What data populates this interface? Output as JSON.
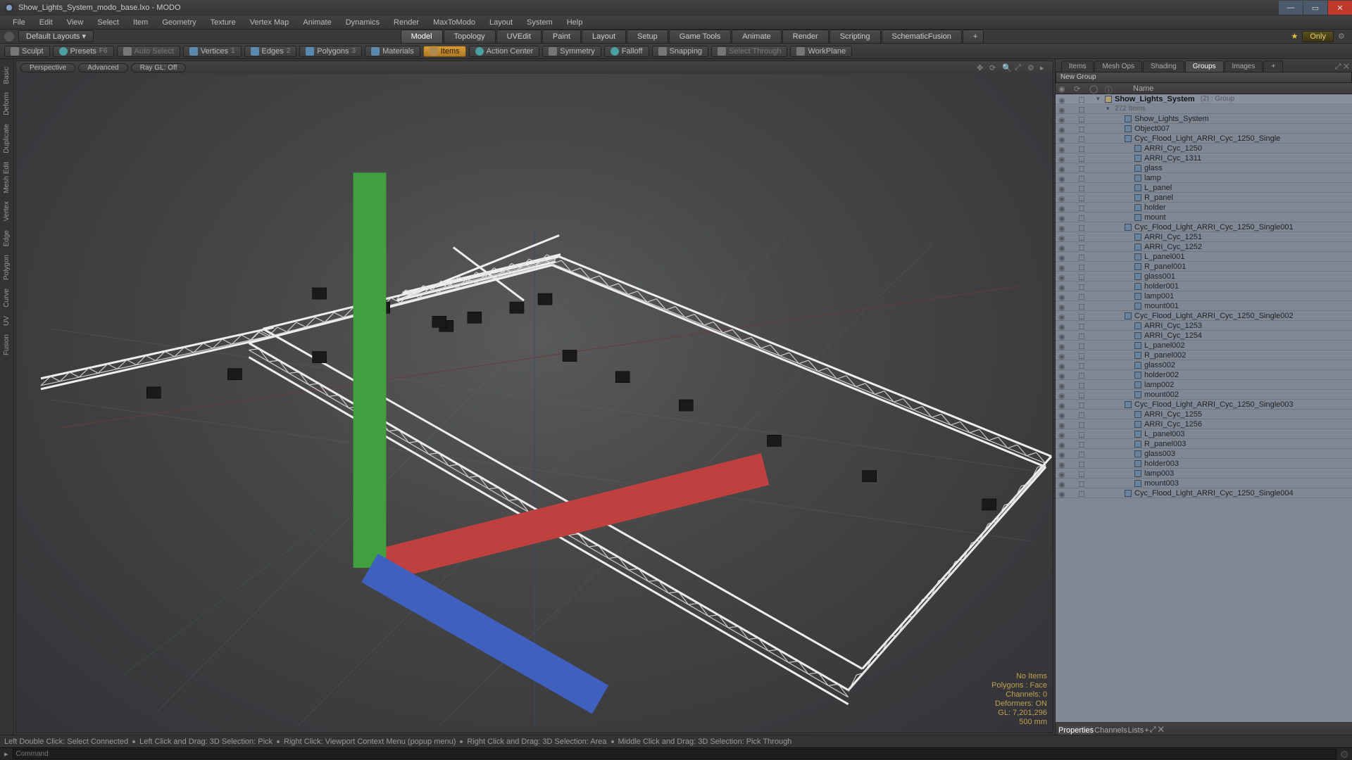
{
  "window": {
    "title": "Show_Lights_System_modo_base.lxo - MODO"
  },
  "menu": [
    "File",
    "Edit",
    "View",
    "Select",
    "Item",
    "Geometry",
    "Texture",
    "Vertex Map",
    "Animate",
    "Dynamics",
    "Render",
    "MaxToModo",
    "Layout",
    "System",
    "Help"
  ],
  "layoutbar": {
    "dropdown": "Default Layouts",
    "tabs": [
      "Model",
      "Topology",
      "UVEdit",
      "Paint",
      "Layout",
      "Setup",
      "Game Tools",
      "Animate",
      "Render",
      "Scripting",
      "SchematicFusion"
    ],
    "active_tab": "Model",
    "only": "Only"
  },
  "toolbar": [
    {
      "label": "Sculpt",
      "icon": "grey"
    },
    {
      "label": "Presets",
      "icon": "cyan",
      "kbd": "F6"
    },
    {
      "label": "Auto Select",
      "icon": "grey",
      "muted": true
    },
    {
      "label": "Vertices",
      "icon": "blue",
      "kbd": "1"
    },
    {
      "label": "Edges",
      "icon": "blue",
      "kbd": "2"
    },
    {
      "label": "Polygons",
      "icon": "blue",
      "kbd": "3"
    },
    {
      "label": "Materials",
      "icon": "blue"
    },
    {
      "label": "Items",
      "icon": "gold",
      "active": true
    },
    {
      "label": "Action Center",
      "icon": "cyan"
    },
    {
      "label": "Symmetry",
      "icon": "grey"
    },
    {
      "label": "Falloff",
      "icon": "cyan"
    },
    {
      "label": "Snapping",
      "icon": "grey"
    },
    {
      "label": "Select Through",
      "icon": "grey",
      "muted": true
    },
    {
      "label": "WorkPlane",
      "icon": "grey"
    }
  ],
  "vtoolbar": [
    "Basic",
    "Deform",
    "Duplicate",
    "Mesh Edit",
    "Vertex",
    "Edge",
    "Polygon",
    "Curve",
    "UV",
    "Fusion"
  ],
  "viewport": {
    "pills": [
      "Perspective",
      "Advanced",
      "Ray GL: Off"
    ],
    "stats": {
      "line1": "No Items",
      "line2": "Polygons : Face",
      "line3": "Channels: 0",
      "line4": "Deformers: ON",
      "line5": "GL: 7,201,296",
      "line6": "500 mm"
    }
  },
  "statusbar": {
    "s1": "Left Double Click: Select Connected",
    "s2": "Left Click and Drag: 3D Selection: Pick",
    "s3": "Right Click: Viewport Context Menu (popup menu)",
    "s4": "Right Click and Drag: 3D Selection: Area",
    "s5": "Middle Click and Drag: 3D Selection: Pick Through"
  },
  "command": {
    "placeholder": "Command"
  },
  "rpanel": {
    "tabs": [
      "Items",
      "Mesh Ops",
      "Shading",
      "Groups",
      "Images"
    ],
    "active_tab": "Groups",
    "new_group": "New Group",
    "header_name": "Name",
    "group_name": "Show_Lights_System",
    "group_count": "(2)",
    "group_suffix": ": Group",
    "group_hint": "272 Items",
    "prop_tabs": [
      "Properties",
      "Channels",
      "Lists"
    ],
    "prop_active": "Properties",
    "items": [
      {
        "n": "Show_Lights_System",
        "i": 2
      },
      {
        "n": "Object007",
        "i": 2
      },
      {
        "n": "Cyc_Flood_Light_ARRI_Cyc_1250_Single",
        "i": 2
      },
      {
        "n": "ARRI_Cyc_1250",
        "i": 3
      },
      {
        "n": "ARRI_Cyc_1311",
        "i": 3
      },
      {
        "n": "glass",
        "i": 3
      },
      {
        "n": "lamp",
        "i": 3
      },
      {
        "n": "L_panel",
        "i": 3
      },
      {
        "n": "R_panel",
        "i": 3
      },
      {
        "n": "holder",
        "i": 3
      },
      {
        "n": "mount",
        "i": 3
      },
      {
        "n": "Cyc_Flood_Light_ARRI_Cyc_1250_Single001",
        "i": 2
      },
      {
        "n": "ARRI_Cyc_1251",
        "i": 3
      },
      {
        "n": "ARRI_Cyc_1252",
        "i": 3
      },
      {
        "n": "L_panel001",
        "i": 3
      },
      {
        "n": "R_panel001",
        "i": 3
      },
      {
        "n": "glass001",
        "i": 3
      },
      {
        "n": "holder001",
        "i": 3
      },
      {
        "n": "lamp001",
        "i": 3
      },
      {
        "n": "mount001",
        "i": 3
      },
      {
        "n": "Cyc_Flood_Light_ARRI_Cyc_1250_Single002",
        "i": 2
      },
      {
        "n": "ARRI_Cyc_1253",
        "i": 3
      },
      {
        "n": "ARRI_Cyc_1254",
        "i": 3
      },
      {
        "n": "L_panel002",
        "i": 3
      },
      {
        "n": "R_panel002",
        "i": 3
      },
      {
        "n": "glass002",
        "i": 3
      },
      {
        "n": "holder002",
        "i": 3
      },
      {
        "n": "lamp002",
        "i": 3
      },
      {
        "n": "mount002",
        "i": 3
      },
      {
        "n": "Cyc_Flood_Light_ARRI_Cyc_1250_Single003",
        "i": 2
      },
      {
        "n": "ARRI_Cyc_1255",
        "i": 3
      },
      {
        "n": "ARRI_Cyc_1256",
        "i": 3
      },
      {
        "n": "L_panel003",
        "i": 3
      },
      {
        "n": "R_panel003",
        "i": 3
      },
      {
        "n": "glass003",
        "i": 3
      },
      {
        "n": "holder003",
        "i": 3
      },
      {
        "n": "lamp003",
        "i": 3
      },
      {
        "n": "mount003",
        "i": 3
      },
      {
        "n": "Cyc_Flood_Light_ARRI_Cyc_1250_Single004",
        "i": 2
      }
    ]
  }
}
